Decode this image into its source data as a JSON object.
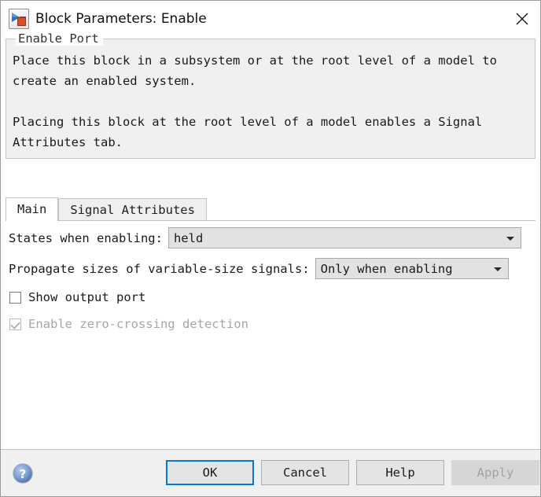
{
  "window": {
    "title": "Block Parameters: Enable",
    "icon": "enable-port-block-icon",
    "close_label": "✕"
  },
  "group": {
    "legend": "Enable Port",
    "paragraphs": [
      "Place this block in a subsystem or at the root level of a model to create an enabled system.",
      "Placing this block at the root level of a model enables a Signal Attributes tab."
    ]
  },
  "tabs": [
    {
      "label": "Main",
      "active": true
    },
    {
      "label": "Signal Attributes",
      "active": false
    }
  ],
  "main_tab": {
    "states_when_enabling": {
      "label": "States when enabling:",
      "value": "held"
    },
    "propagate_sizes": {
      "label": "Propagate sizes of variable-size signals:",
      "value": "Only when enabling"
    },
    "show_output_port": {
      "label": "Show output port",
      "checked": false,
      "enabled": true
    },
    "zero_crossing": {
      "label": "Enable zero-crossing detection",
      "checked": true,
      "enabled": false
    }
  },
  "footer": {
    "help_icon": "help-question-icon",
    "buttons": [
      {
        "label": "OK",
        "state": "default"
      },
      {
        "label": "Cancel",
        "state": "normal"
      },
      {
        "label": "Help",
        "state": "normal"
      },
      {
        "label": "Apply",
        "state": "disabled"
      }
    ]
  },
  "colors": {
    "accent": "#0a78d1",
    "panel": "#f0f0f0",
    "field": "#e2e2e2",
    "border": "#c4c4c4",
    "icon_blue": "#2f6fc0",
    "icon_orange": "#d9502a"
  }
}
